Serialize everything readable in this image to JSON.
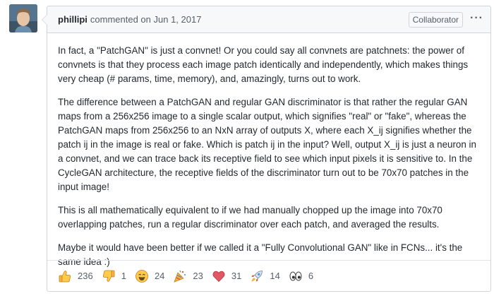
{
  "comment": {
    "author": "phillipi",
    "action": "commented on Jun 1, 2017",
    "role_badge": "Collaborator",
    "more_icon": "···",
    "paragraphs": [
      "In fact, a \"PatchGAN\" is just a convnet! Or you could say all convnets are patchnets: the power of convnets is that they process each image patch identically and independently, which makes things very cheap (# params, time, memory), and, amazingly, turns out to work.",
      "The difference between a PatchGAN and regular GAN discriminator is that rather the regular GAN maps from a 256x256 image to a single scalar output, which signifies \"real\" or \"fake\", whereas the PatchGAN maps from 256x256 to an NxN array of outputs X, where each X_ij signifies whether the patch ij in the image is real or fake. Which is patch ij in the input? Well, output X_ij is just a neuron in a convnet, and we can trace back its receptive field to see which input pixels it is sensitive to. In the CycleGAN architecture, the receptive fields of the discriminator turn out to be 70x70 patches in the input image!",
      "This is all mathematically equivalent to if we had manually chopped up the image into 70x70 overlapping patches, run a regular discriminator over each patch, and averaged the results.",
      "Maybe it would have been better if we called it a \"Fully Convolutional GAN\" like in FCNs... it's the same idea :)"
    ]
  },
  "reactions": [
    {
      "icon": "thumbs-up-icon",
      "count": "236"
    },
    {
      "icon": "thumbs-down-icon",
      "count": "1"
    },
    {
      "icon": "laugh-icon",
      "count": "24"
    },
    {
      "icon": "hooray-icon",
      "count": "23"
    },
    {
      "icon": "heart-icon",
      "count": "31"
    },
    {
      "icon": "rocket-icon",
      "count": "14"
    },
    {
      "icon": "eyes-icon",
      "count": "6"
    }
  ]
}
